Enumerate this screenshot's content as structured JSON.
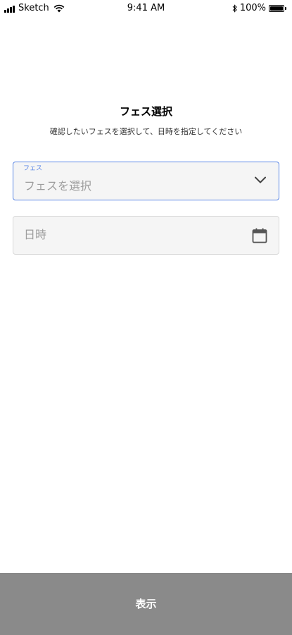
{
  "status_bar": {
    "carrier": "Sketch",
    "time": "9:41 AM",
    "battery_percent": "100%",
    "battery_level": 1.0,
    "icons": [
      "signal-icon",
      "wifi-icon",
      "bluetooth-icon",
      "battery-icon"
    ]
  },
  "header": {
    "title": "フェス選択",
    "subtitle": "確認したいフェスを選択して、日時を指定してください"
  },
  "fes_select": {
    "label": "フェス",
    "placeholder": "フェスを選択",
    "icon": "chevron-down-icon"
  },
  "date_field": {
    "placeholder": "日時",
    "icon": "calendar-icon"
  },
  "footer": {
    "show_label": "表示"
  },
  "colors": {
    "accent": "#5b86e5",
    "field_background": "#f5f5f5",
    "field_border": "#d9d9d9",
    "placeholder": "#9e9e9e",
    "button_background": "#8a8a8a",
    "button_text": "#ffffff"
  }
}
